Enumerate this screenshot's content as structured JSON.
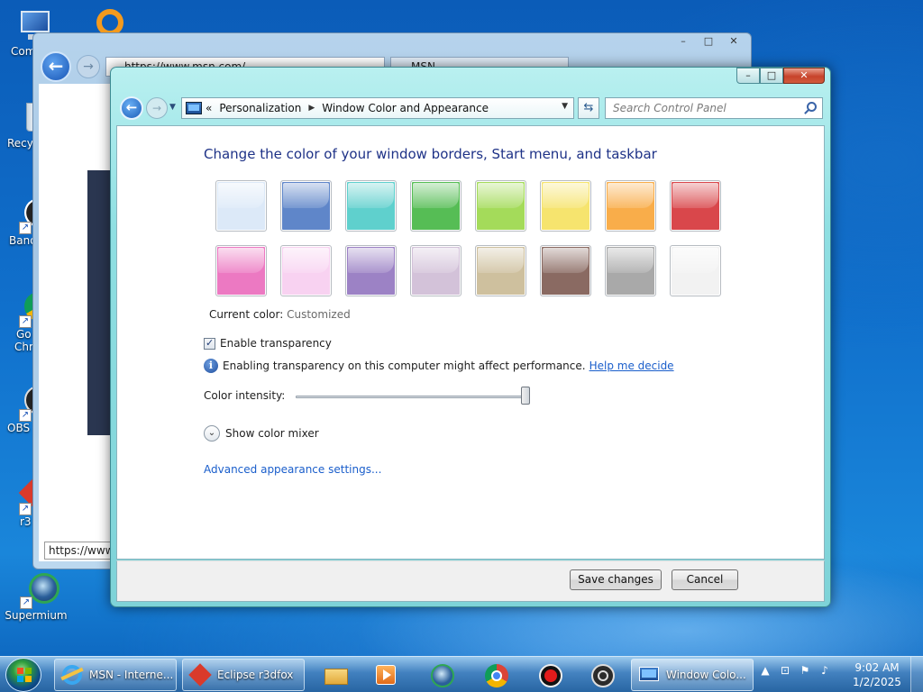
{
  "desktop": {
    "icons": [
      {
        "label": "Com",
        "icon": "computer-icon"
      },
      {
        "label": "Recy",
        "icon": "recycle-bin-icon"
      },
      {
        "label": "Band",
        "icon": "bandicam-icon"
      },
      {
        "label": "Go",
        "label2": "Chr",
        "icon": "chrome-icon"
      },
      {
        "label": "OBS",
        "icon": "obs-icon"
      },
      {
        "label": "r3",
        "icon": "r3dfox-icon"
      },
      {
        "label": "Supermium",
        "icon": "supermium-icon"
      }
    ]
  },
  "ie_window": {
    "address": "https://www.msn.com/",
    "tab_title": "MSN",
    "status_url": "https://www"
  },
  "dialog": {
    "controls": {
      "minimize": "–",
      "maximize": "□",
      "close": "✕"
    },
    "breadcrumb": {
      "prefix": "«",
      "items": [
        "Personalization",
        "Window Color and Appearance"
      ]
    },
    "search_placeholder": "Search Control Panel",
    "heading": "Change the color of your window borders, Start menu, and taskbar",
    "swatches": [
      {
        "name": "sky",
        "color": "#dce9f8"
      },
      {
        "name": "twilight",
        "color": "#5f86c9"
      },
      {
        "name": "sea",
        "color": "#5fd0cd"
      },
      {
        "name": "leaf",
        "color": "#56bd55"
      },
      {
        "name": "lime",
        "color": "#a4db5a"
      },
      {
        "name": "lemon",
        "color": "#f6e46e"
      },
      {
        "name": "pumpkin",
        "color": "#f9ad4a"
      },
      {
        "name": "ruby",
        "color": "#d9474b"
      },
      {
        "name": "fuchsia",
        "color": "#ec79c2"
      },
      {
        "name": "blush",
        "color": "#f8d2f1"
      },
      {
        "name": "violet",
        "color": "#9c82c5"
      },
      {
        "name": "lavender",
        "color": "#d3c2d9"
      },
      {
        "name": "taupe",
        "color": "#cec09e"
      },
      {
        "name": "chocolate",
        "color": "#8a6a62"
      },
      {
        "name": "slate",
        "color": "#a9a9a9"
      },
      {
        "name": "frost",
        "color": "#f2f2f2"
      }
    ],
    "current_color_label": "Current color:",
    "current_color_value": "Customized",
    "enable_transparency_label": "Enable transparency",
    "enable_transparency_checked": true,
    "transparency_note": "Enabling transparency on this computer might affect performance.",
    "help_link": "Help me decide",
    "intensity_label": "Color intensity:",
    "intensity_value": 1.0,
    "mixer_label": "Show color mixer",
    "advanced_link": "Advanced appearance settings...",
    "save_label": "Save changes",
    "cancel_label": "Cancel"
  },
  "taskbar": {
    "items": [
      {
        "label": "MSN - Interne...",
        "icon": "ie-icon"
      },
      {
        "label": "Eclipse r3dfox",
        "icon": "r3dfox-icon"
      },
      {
        "label": "",
        "icon": "folder-icon"
      },
      {
        "label": "",
        "icon": "media-player-icon"
      },
      {
        "label": "",
        "icon": "supermium-icon"
      },
      {
        "label": "",
        "icon": "chrome-icon"
      },
      {
        "label": "",
        "icon": "record-icon"
      },
      {
        "label": "",
        "icon": "obs-icon"
      },
      {
        "label": "Window Colo...",
        "icon": "control-panel-icon"
      }
    ],
    "time": "9:02 AM",
    "date": "1/2/2025"
  }
}
